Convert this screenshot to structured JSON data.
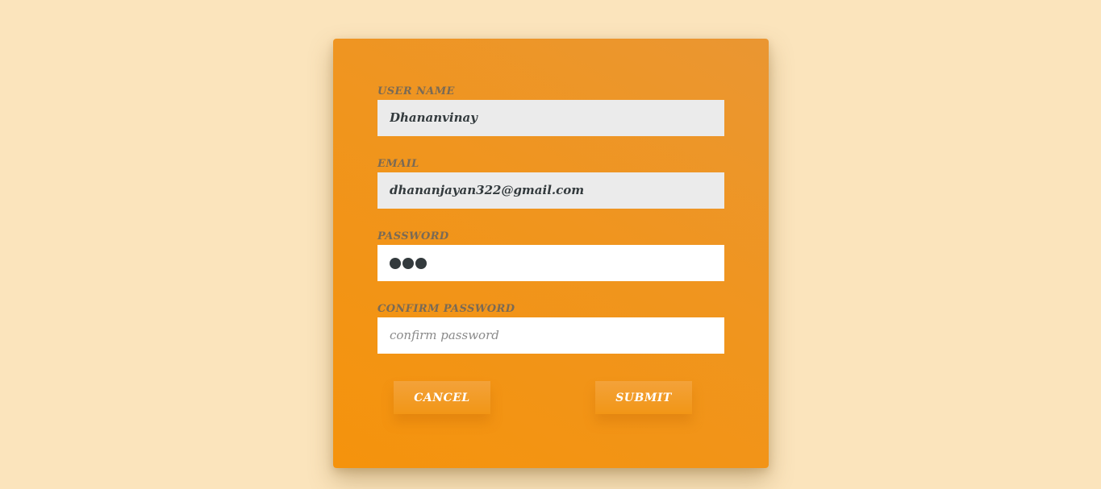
{
  "form": {
    "username": {
      "label": "USER NAME",
      "value": "Dhananvinay"
    },
    "email": {
      "label": "EMAIL",
      "value": "dhananjayan322@gmail.com"
    },
    "password": {
      "label": "PASSWORD",
      "masked_length": 3
    },
    "confirm_password": {
      "label": "CONFIRM PASSWORD",
      "placeholder": "confirm password",
      "value": ""
    },
    "buttons": {
      "cancel_label": "CANCEL",
      "submit_label": "SUBMIT"
    }
  },
  "colors": {
    "page_background": "#fbe4bc",
    "card_background": "#f0951e",
    "label_text": "#7a6a55",
    "input_text": "#333a3d",
    "button_text": "#ffffff"
  }
}
